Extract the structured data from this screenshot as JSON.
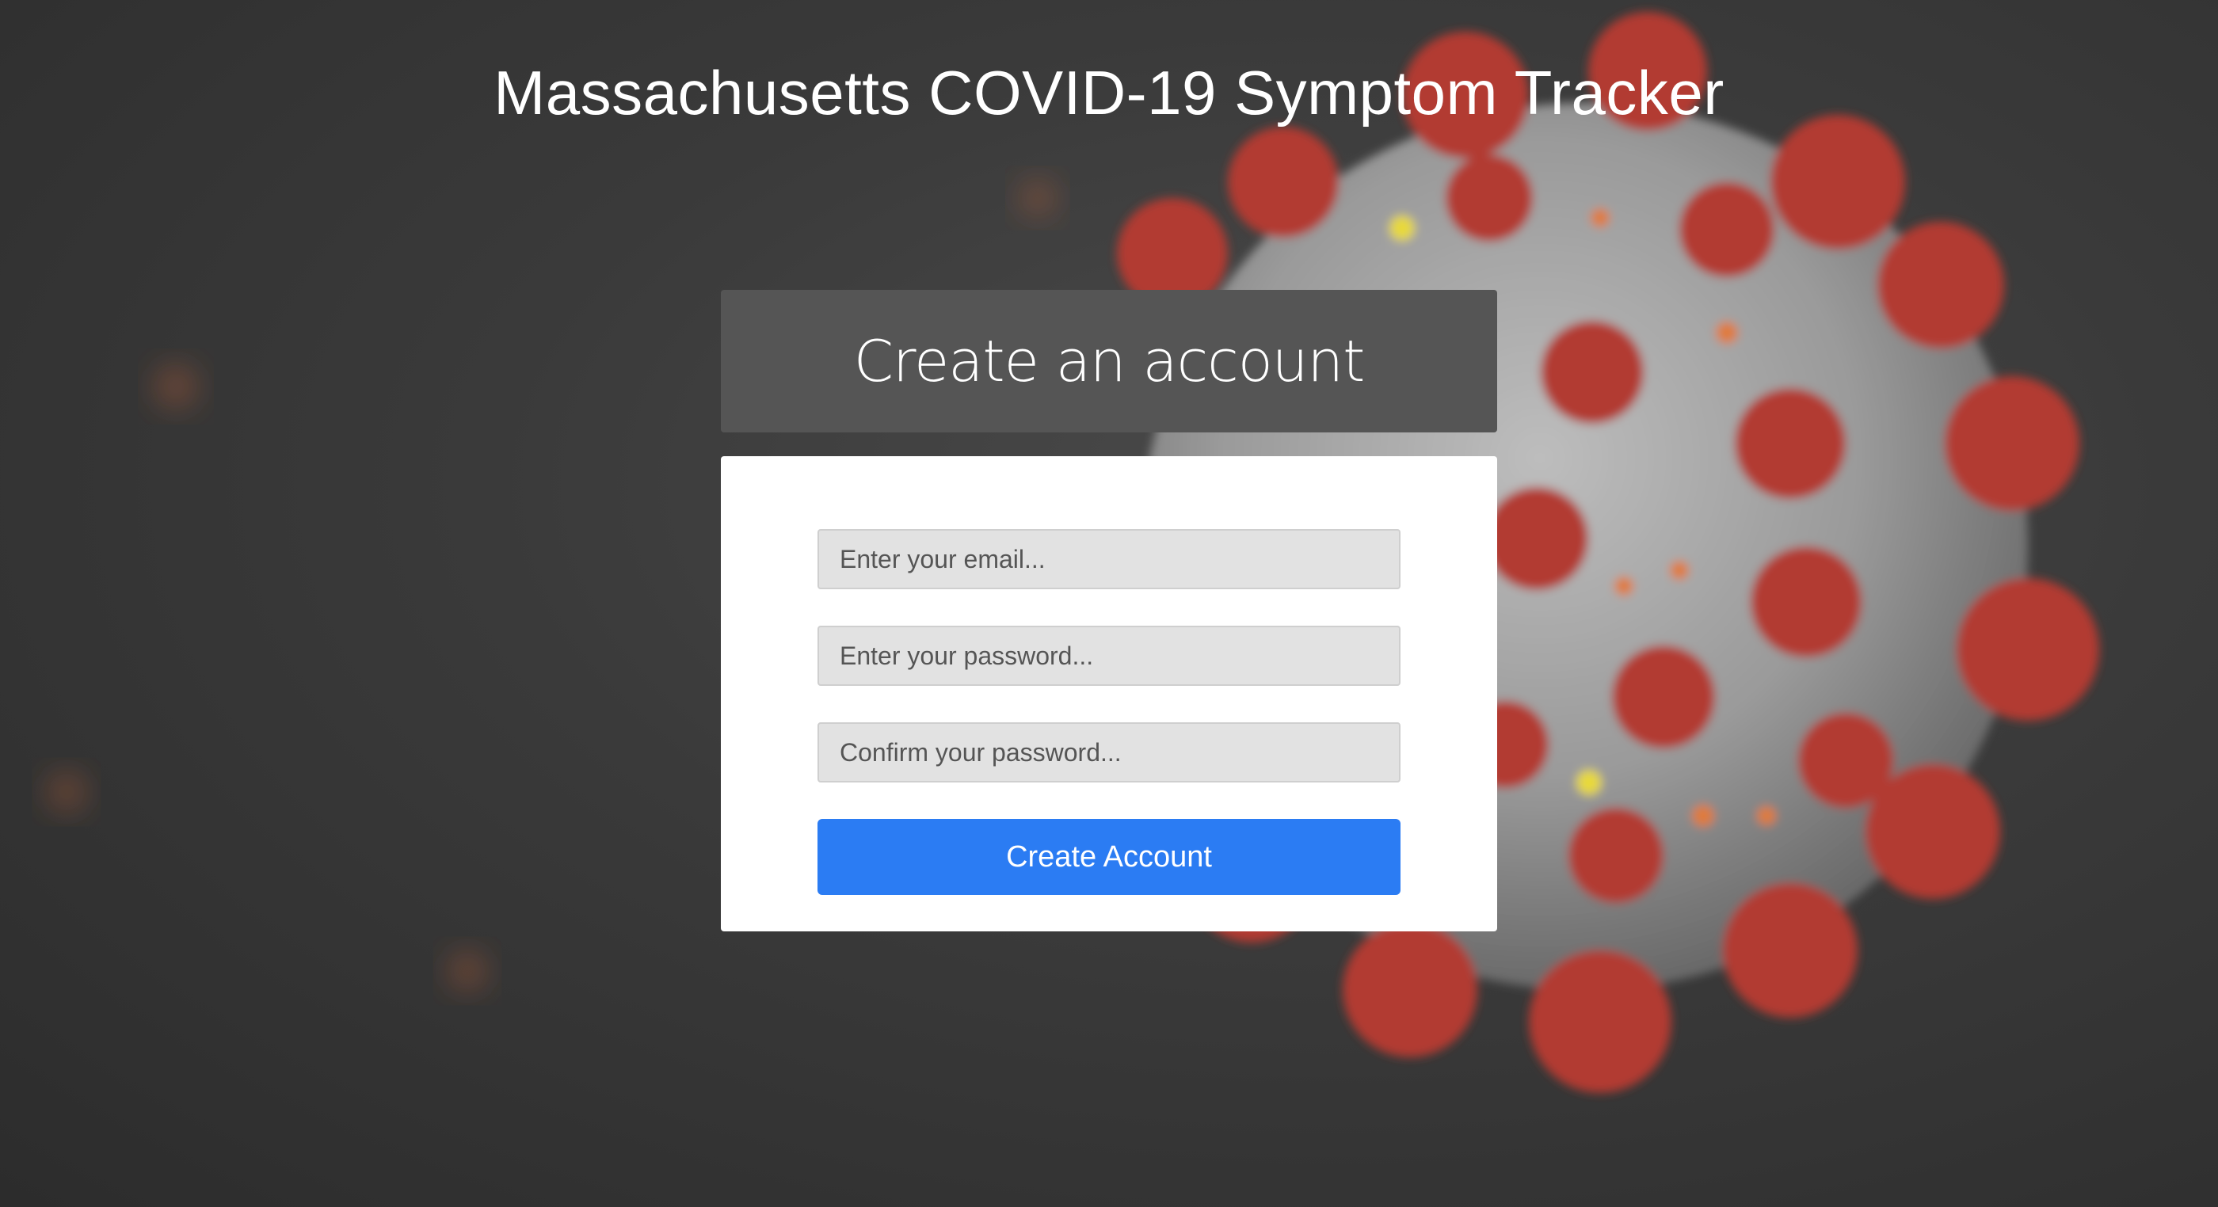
{
  "header": {
    "title": "Massachusetts COVID-19 Symptom Tracker"
  },
  "card": {
    "title": "Create an account"
  },
  "form": {
    "email": {
      "placeholder": "Enter your email...",
      "value": ""
    },
    "password": {
      "placeholder": "Enter your password...",
      "value": ""
    },
    "confirm_password": {
      "placeholder": "Confirm your password...",
      "value": ""
    },
    "submit_label": "Create Account"
  },
  "colors": {
    "background": "#3a3a3a",
    "card_header": "#555555",
    "button": "#2b7cf3",
    "virus_spike": "#b23a33",
    "virus_body": "#9c9c9c"
  }
}
